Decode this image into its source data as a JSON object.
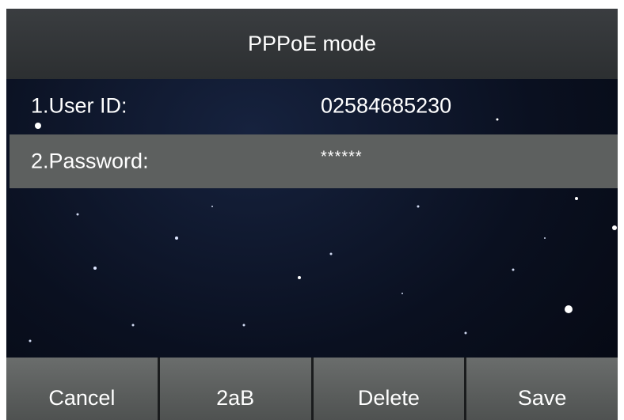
{
  "screen": {
    "title": "PPPoE mode",
    "fields": [
      {
        "label": "1.User ID:",
        "value": "02584685230",
        "selected": false
      },
      {
        "label": "2.Password:",
        "value": "******",
        "selected": true
      }
    ],
    "softkeys": [
      {
        "label": "Cancel"
      },
      {
        "label": "2aB"
      },
      {
        "label": "Delete"
      },
      {
        "label": "Save"
      }
    ]
  },
  "colors": {
    "title_bar": "#2f3234",
    "selected_row": "#5d605f",
    "softkey": "#5c5f5e",
    "background": "#0a1020"
  }
}
